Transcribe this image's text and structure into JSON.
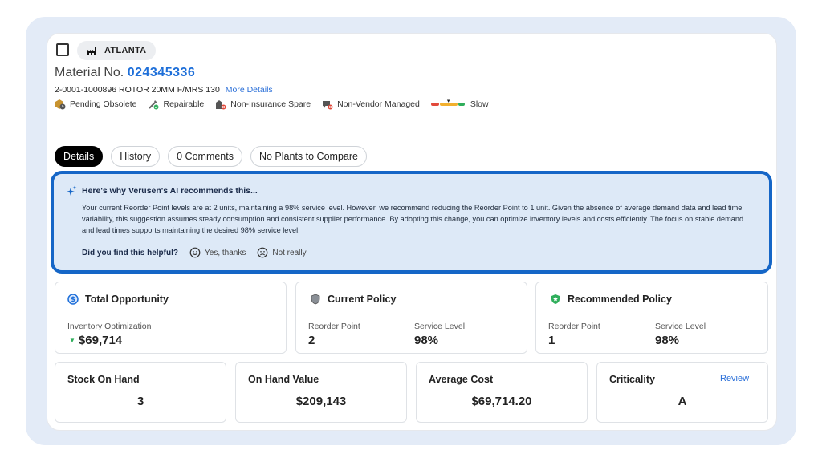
{
  "header": {
    "location": "ATLANTA",
    "material_prefix": "Material No. ",
    "material_number": "024345336",
    "description": "2-0001-1000896 ROTOR 20MM F/MRS 130",
    "more_details": "More Details",
    "attributes": [
      {
        "label": "Pending Obsolete",
        "icon": "box-clock-icon"
      },
      {
        "label": "Repairable",
        "icon": "tools-icon"
      },
      {
        "label": "Non-Insurance Spare",
        "icon": "building-x-icon"
      },
      {
        "label": "Non-Vendor Managed",
        "icon": "truck-x-icon"
      },
      {
        "label": "Slow",
        "icon": "velocity-bar-icon"
      }
    ]
  },
  "tabs": [
    {
      "label": "Details",
      "active": true
    },
    {
      "label": "History",
      "active": false
    },
    {
      "label": "0 Comments",
      "active": false
    },
    {
      "label": "No Plants to Compare",
      "active": false
    }
  ],
  "ai": {
    "title": "Here's why Verusen's AI recommends this...",
    "body": "Your current Reorder Point levels are at 2 units, maintaining a 98% service level. However, we recommend reducing the Reorder Point to 1 unit. Given the absence of average demand data and lead time variability, this suggestion assumes steady consumption and consistent supplier performance. By adopting this change, you can optimize inventory levels and costs efficiently. The focus on stable demand and lead times supports maintaining the desired 98% service level.",
    "question": "Did you find this helpful?",
    "yes": "Yes, thanks",
    "no": "Not really"
  },
  "opportunity": {
    "title": "Total Opportunity",
    "label": "Inventory Optimization",
    "value": "$69,714"
  },
  "current_policy": {
    "title": "Current Policy",
    "rop_label": "Reorder Point",
    "rop_value": "2",
    "sl_label": "Service Level",
    "sl_value": "98%"
  },
  "recommended_policy": {
    "title": "Recommended Policy",
    "rop_label": "Reorder Point",
    "rop_value": "1",
    "sl_label": "Service Level",
    "sl_value": "98%"
  },
  "stats": {
    "stock_on_hand": {
      "label": "Stock On Hand",
      "value": "3"
    },
    "on_hand_value": {
      "label": "On Hand Value",
      "value": "$209,143"
    },
    "average_cost": {
      "label": "Average Cost",
      "value": "$69,714.20"
    },
    "criticality": {
      "label": "Criticality",
      "value": "A",
      "action": "Review"
    }
  },
  "colors": {
    "accent": "#1e6fd9",
    "ai_border": "#1566c7",
    "ai_bg": "#dde9f7",
    "green": "#2fae5b"
  }
}
